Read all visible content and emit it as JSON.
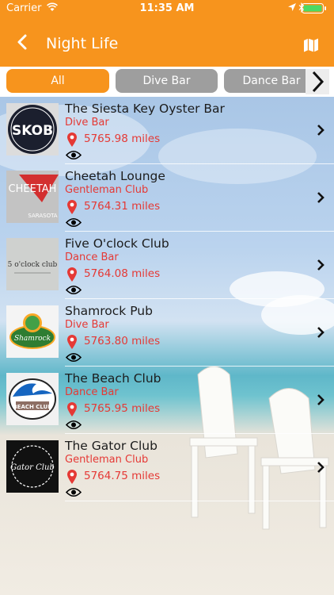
{
  "status_bar": {
    "carrier": "Carrier",
    "time": "11:35 AM"
  },
  "nav": {
    "title": "Night Life",
    "back_icon": "chevron-left-icon",
    "map_icon": "map-icon"
  },
  "filters": [
    {
      "label": "All",
      "active": true
    },
    {
      "label": "Dive Bar",
      "active": false
    },
    {
      "label": "Dance Bar",
      "active": false
    }
  ],
  "venues": [
    {
      "name": "The Siesta Key Oyster Bar",
      "category": "Dive Bar",
      "distance": "5765.98 miles",
      "logo_text": "SKOB"
    },
    {
      "name": "Cheetah Lounge",
      "category": "Gentleman Club",
      "distance": "5764.31 miles",
      "logo_text": "CHEETAH",
      "logo_sub": "SARASOTA"
    },
    {
      "name": "Five O'clock Club",
      "category": "Dance Bar",
      "distance": "5764.08 miles",
      "logo_text": "5 o'clock club"
    },
    {
      "name": "Shamrock Pub",
      "category": "Dive Bar",
      "distance": "5763.80 miles",
      "logo_text": "Shamrock"
    },
    {
      "name": "The Beach Club",
      "category": "Dance Bar",
      "distance": "5765.95 miles",
      "logo_text": "BEACH CLUB"
    },
    {
      "name": "The Gator Club",
      "category": "Gentleman Club",
      "distance": "5764.75 miles",
      "logo_text": "Gator Club"
    }
  ],
  "colors": {
    "accent": "#f7941d",
    "category_text": "#e53935",
    "inactive_pill": "#9e9e9e"
  }
}
